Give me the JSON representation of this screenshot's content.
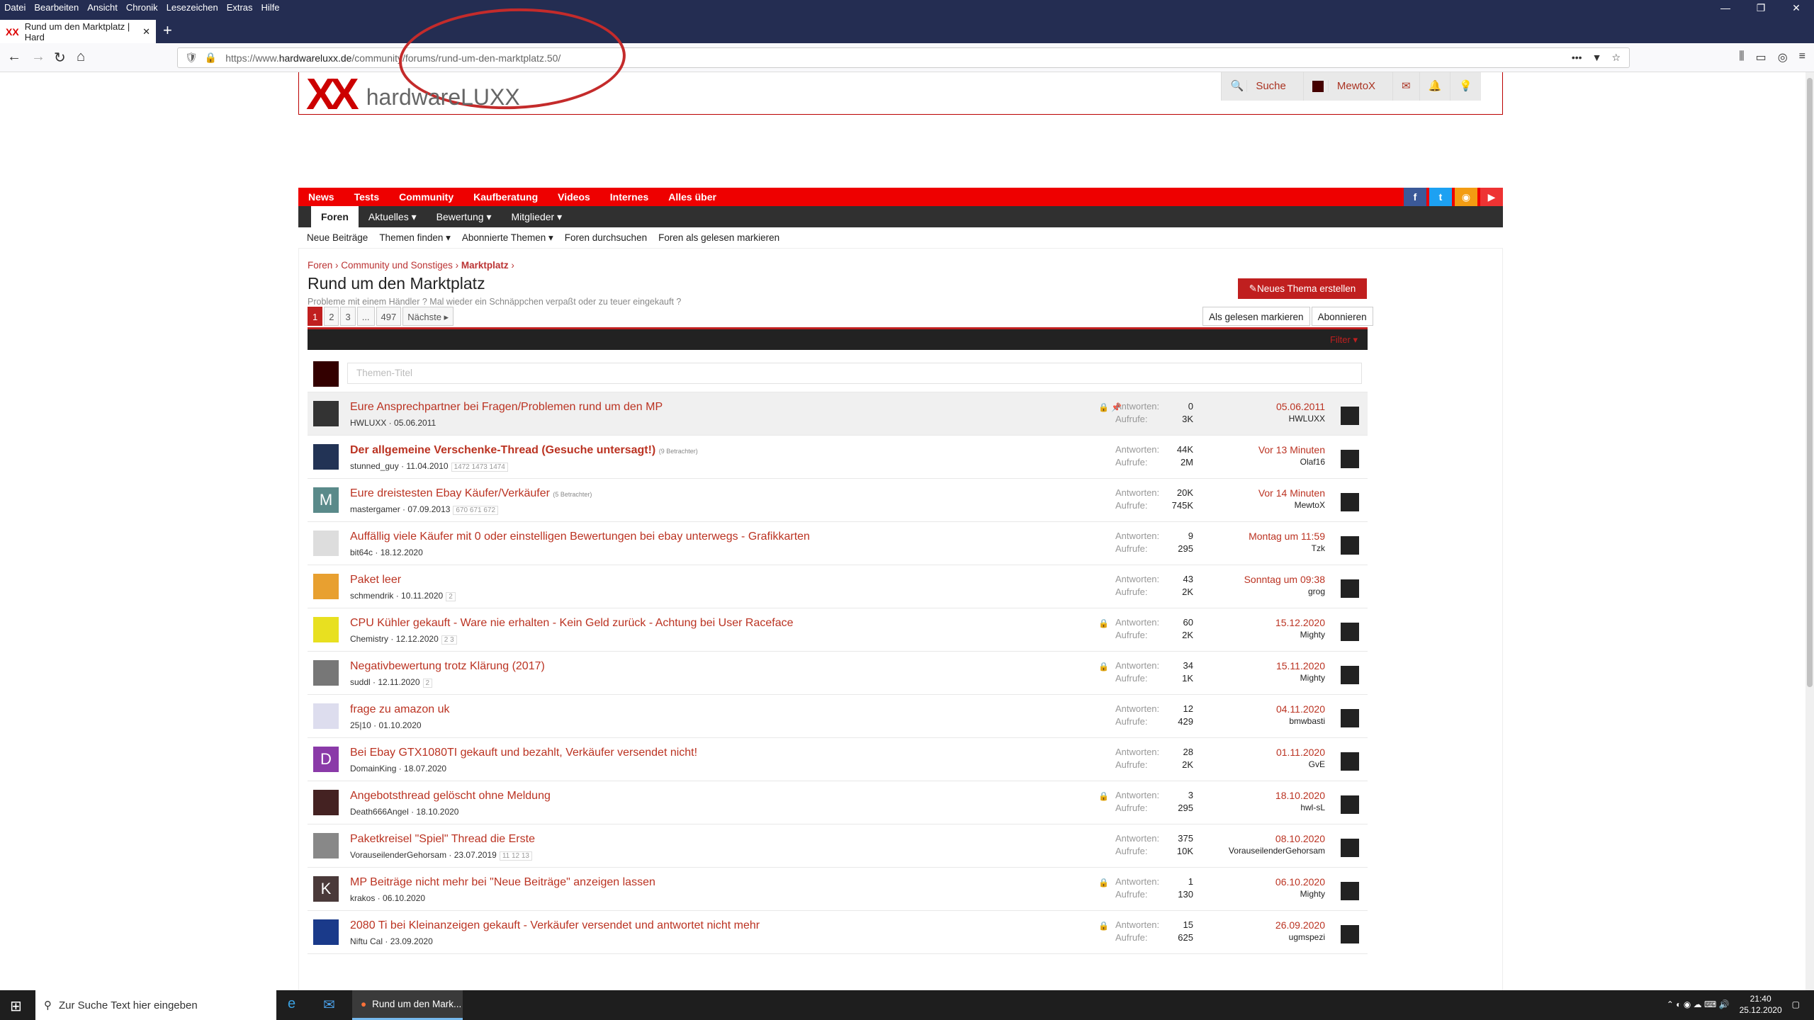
{
  "browser": {
    "menu": [
      "Datei",
      "Bearbeiten",
      "Ansicht",
      "Chronik",
      "Lesezeichen",
      "Extras",
      "Hilfe"
    ],
    "tab_title": "Rund um den Marktplatz | Hard",
    "url_prefix": "https://www.",
    "url_domain": "hardwareluxx.de",
    "url_path": "/community/forums/rund-um-den-marktplatz.50/"
  },
  "site": {
    "logo_mark": "XX",
    "logo_text": "hardwareLUXX",
    "search_label": "Suche",
    "user_label": "MewtoX",
    "main_nav": [
      "News",
      "Tests",
      "Community",
      "Kaufberatung",
      "Videos",
      "Internes",
      "Alles über"
    ],
    "sub_nav": [
      "Foren",
      "Aktuelles ▾",
      "Bewertung ▾",
      "Mitglieder ▾"
    ],
    "sub_sub": [
      "Neue Beiträge",
      "Themen finden ▾",
      "Abonnierte Themen ▾",
      "Foren durchsuchen",
      "Foren als gelesen markieren"
    ],
    "social": [
      "f",
      "t",
      "rss",
      "yt"
    ]
  },
  "forum": {
    "breadcrumb": [
      "Foren",
      "Community und Sonstiges",
      "Marktplatz"
    ],
    "title": "Rund um den Marktplatz",
    "description": "Probleme mit einem Händler ? Mal wieder ein Schnäppchen verpaßt oder zu teuer eingekauft ?",
    "new_thread": "Neues Thema erstellen",
    "pages": [
      "1",
      "2",
      "3",
      "...",
      "497",
      "Nächste ▸"
    ],
    "mark_read": "Als gelesen markieren",
    "subscribe": "Abonnieren",
    "filter": "Filter ▾",
    "filter_placeholder": "Themen-Titel",
    "replies_label": "Antworten:",
    "views_label": "Aufrufe:"
  },
  "threads": [
    {
      "title": "Eure Ansprechpartner bei Fragen/Problemen rund um den MP",
      "extra": "",
      "bold": false,
      "sticky": true,
      "author": "HWLUXX",
      "date": "05.06.2011",
      "pages": "",
      "icons": "🔒 📌",
      "replies": "0",
      "views": "3K",
      "last_date": "05.06.2011",
      "last_user": "HWLUXX",
      "av": "",
      "av_color": "#333"
    },
    {
      "title": "Der allgemeine Verschenke-Thread (Gesuche untersagt!)",
      "extra": "(9 Betrachter)",
      "bold": true,
      "sticky": false,
      "author": "stunned_guy",
      "date": "11.04.2010",
      "pages": "1472 1473 1474",
      "icons": "",
      "replies": "44K",
      "views": "2M",
      "last_date": "Vor 13 Minuten",
      "last_user": "Olaf16",
      "av": "",
      "av_color": "#235"
    },
    {
      "title": "Eure dreistesten Ebay Käufer/Verkäufer",
      "extra": "(5 Betrachter)",
      "bold": false,
      "sticky": false,
      "author": "mastergamer",
      "date": "07.09.2013",
      "pages": "670 671 672",
      "icons": "",
      "replies": "20K",
      "views": "745K",
      "last_date": "Vor 14 Minuten",
      "last_user": "MewtoX",
      "av": "M",
      "av_color": "#5a8a8a"
    },
    {
      "title": "Auffällig viele Käufer mit 0 oder einstelligen Bewertungen bei ebay unterwegs - Grafikkarten",
      "extra": "",
      "bold": false,
      "sticky": false,
      "author": "bit64c",
      "date": "18.12.2020",
      "pages": "",
      "icons": "",
      "replies": "9",
      "views": "295",
      "last_date": "Montag um 11:59",
      "last_user": "Tzk",
      "av": "",
      "av_color": "#ddd"
    },
    {
      "title": "Paket leer",
      "extra": "",
      "bold": false,
      "sticky": false,
      "author": "schmendrik",
      "date": "10.11.2020",
      "pages": "2",
      "icons": "",
      "replies": "43",
      "views": "2K",
      "last_date": "Sonntag um 09:38",
      "last_user": "grog",
      "av": "",
      "av_color": "#e8a030"
    },
    {
      "title": "CPU Kühler gekauft - Ware nie erhalten - Kein Geld zurück - Achtung bei User Raceface",
      "extra": "",
      "bold": false,
      "sticky": false,
      "author": "Chemistry",
      "date": "12.12.2020",
      "pages": "2 3",
      "icons": "🔒",
      "replies": "60",
      "views": "2K",
      "last_date": "15.12.2020",
      "last_user": "Mighty",
      "av": "",
      "av_color": "#e8e020"
    },
    {
      "title": "Negativbewertung trotz Klärung (2017)",
      "extra": "",
      "bold": false,
      "sticky": false,
      "author": "suddl",
      "date": "12.11.2020",
      "pages": "2",
      "icons": "🔒",
      "replies": "34",
      "views": "1K",
      "last_date": "15.11.2020",
      "last_user": "Mighty",
      "av": "",
      "av_color": "#777"
    },
    {
      "title": "frage zu amazon uk",
      "extra": "",
      "bold": false,
      "sticky": false,
      "author": "25|10",
      "date": "01.10.2020",
      "pages": "",
      "icons": "",
      "replies": "12",
      "views": "429",
      "last_date": "04.11.2020",
      "last_user": "bmwbasti",
      "av": "",
      "av_color": "#dde"
    },
    {
      "title": "Bei Ebay GTX1080TI gekauft und bezahlt, Verkäufer versendet nicht!",
      "extra": "",
      "bold": false,
      "sticky": false,
      "author": "DomainKing",
      "date": "18.07.2020",
      "pages": "",
      "icons": "",
      "replies": "28",
      "views": "2K",
      "last_date": "01.11.2020",
      "last_user": "GvE",
      "av": "D",
      "av_color": "#8a3aa8"
    },
    {
      "title": "Angebotsthread gelöscht ohne Meldung",
      "extra": "",
      "bold": false,
      "sticky": false,
      "author": "Death666Angel",
      "date": "18.10.2020",
      "pages": "",
      "icons": "🔒",
      "replies": "3",
      "views": "295",
      "last_date": "18.10.2020",
      "last_user": "hwl-sL",
      "av": "",
      "av_color": "#422"
    },
    {
      "title": "Paketkreisel \"Spiel\" Thread die Erste",
      "extra": "",
      "bold": false,
      "sticky": false,
      "author": "VorauseilenderGehorsam",
      "date": "23.07.2019",
      "pages": "11 12 13",
      "icons": "",
      "replies": "375",
      "views": "10K",
      "last_date": "08.10.2020",
      "last_user": "VorauseilenderGehorsam",
      "av": "",
      "av_color": "#888"
    },
    {
      "title": "MP Beiträge nicht mehr bei \"Neue Beiträge\" anzeigen lassen",
      "extra": "",
      "bold": false,
      "sticky": false,
      "author": "krakos",
      "date": "06.10.2020",
      "pages": "",
      "icons": "🔒",
      "replies": "1",
      "views": "130",
      "last_date": "06.10.2020",
      "last_user": "Mighty",
      "av": "K",
      "av_color": "#4a3a3a"
    },
    {
      "title": "2080 Ti bei Kleinanzeigen gekauft - Verkäufer versendet und antwortet nicht mehr",
      "extra": "",
      "bold": false,
      "sticky": false,
      "author": "Niftu Cal",
      "date": "23.09.2020",
      "pages": "",
      "icons": "🔒",
      "replies": "15",
      "views": "625",
      "last_date": "26.09.2020",
      "last_user": "ugmspezi",
      "av": "",
      "av_color": "#1a3a8a"
    }
  ],
  "taskbar": {
    "search_placeholder": "Zur Suche Text hier eingeben",
    "app_label": "Rund um den Mark...",
    "time": "21:40",
    "date": "25.12.2020"
  }
}
